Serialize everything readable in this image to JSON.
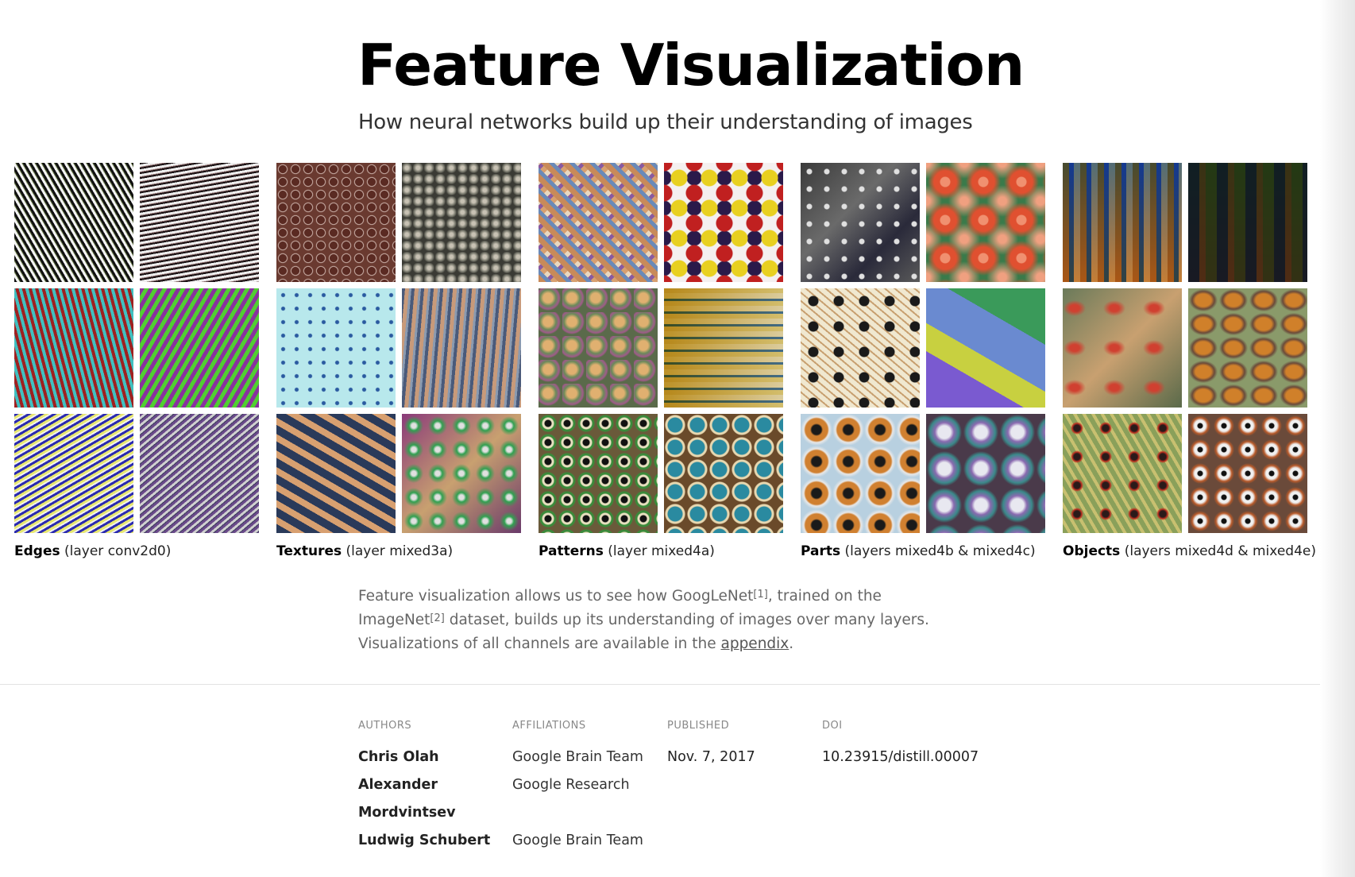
{
  "header": {
    "title": "Feature Visualization",
    "subtitle": "How neural networks build up their understanding of images"
  },
  "figure": {
    "groups": [
      {
        "name": "Edges",
        "detail": " (layer conv2d0)"
      },
      {
        "name": "Textures",
        "detail": " (layer mixed3a)"
      },
      {
        "name": "Patterns",
        "detail": " (layer mixed4a)"
      },
      {
        "name": "Parts",
        "detail": " (layers mixed4b & mixed4c)"
      },
      {
        "name": "Objects",
        "detail": " (layers mixed4d & mixed4e)"
      }
    ]
  },
  "description": {
    "part1": "Feature visualization allows us to see how GoogLeNet",
    "cite1": "[1]",
    "part2": ", trained on the ImageNet",
    "cite2": "[2]",
    "part3": " dataset, builds up its understanding of images over many layers. Visualizations of all channels are available in the ",
    "link": "appendix",
    "part4": "."
  },
  "byline": {
    "authors_label": "AUTHORS",
    "affiliations_label": "AFFILIATIONS",
    "published_label": "PUBLISHED",
    "doi_label": "DOI",
    "authors": [
      "Chris Olah",
      "Alexander",
      "Mordvintsev",
      "Ludwig Schubert"
    ],
    "affiliations": [
      "Google Brain Team",
      "Google Research",
      "",
      "Google Brain Team"
    ],
    "published": "Nov. 7, 2017",
    "doi": "10.23915/distill.00007"
  }
}
